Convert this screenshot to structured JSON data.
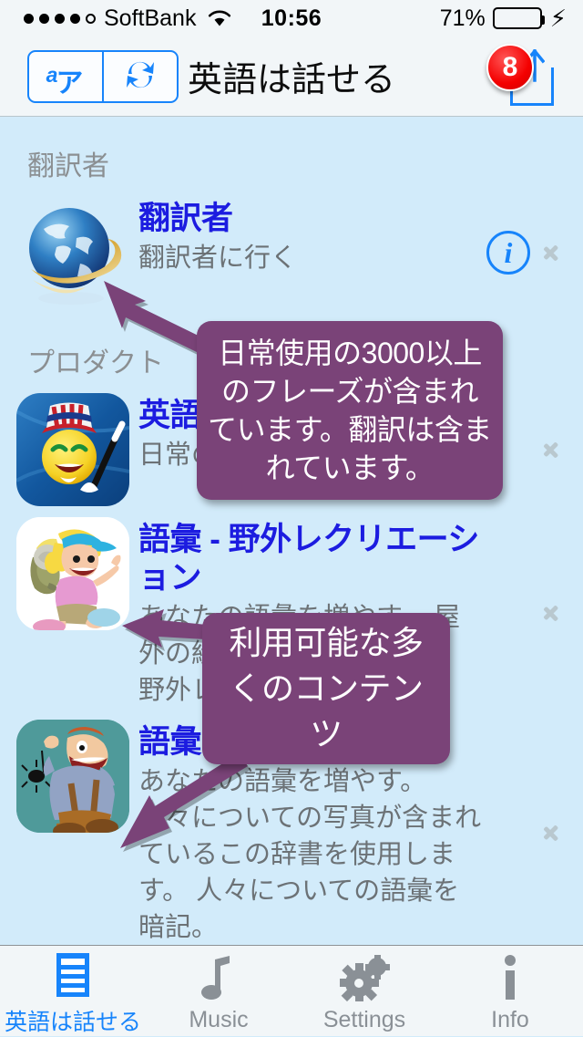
{
  "status_bar": {
    "signal_dots_filled": 4,
    "signal_dots_total": 5,
    "carrier": "SoftBank",
    "wifi_icon": "wifi-icon",
    "time": "10:56",
    "battery_percent": "71%",
    "battery_level": 71,
    "charging": true,
    "battery_color": "#4cd964"
  },
  "navbar": {
    "segmented": {
      "lang_a": "a",
      "lang_kana": "ア",
      "swap_icon": "swap-arrows-icon"
    },
    "title": "英語は話せる",
    "share_icon": "share-icon",
    "badge_count": "8",
    "badge_color": "#f40000",
    "accent_color": "#1784fb"
  },
  "sections": [
    {
      "header": "翻訳者",
      "rows": [
        {
          "icon": "globe-icon",
          "title": "翻訳者",
          "subtitle": "翻訳者に行く",
          "has_info_button": true,
          "info_icon": "info-circle-icon",
          "chevron": "chevron-right-icon"
        }
      ]
    },
    {
      "header": "プロダクト",
      "rows": [
        {
          "icon": "smiley-magician-icon",
          "title": "英語は話せる",
          "subtitle": "日常の英語の言い回し",
          "has_info_button": false,
          "chevron": "chevron-right-icon"
        },
        {
          "icon": "hiker-girl-icon",
          "title": "語彙 - 野外レクリエーション",
          "subtitle": "あなたの語彙を増やす。 屋外の絵辞書を使用します。 野外レクリエーション。",
          "has_info_button": false,
          "chevron": "chevron-right-icon"
        },
        {
          "icon": "cartoon-man-icon",
          "title": "語彙 - 人",
          "subtitle": "あなたの語彙を増やす。 人々についての写真が含まれているこの辞書を使用します。 人々についての語彙を暗記。",
          "has_info_button": false,
          "chevron": "chevron-right-icon"
        }
      ]
    }
  ],
  "tooltips": [
    {
      "name": "translator-tooltip",
      "text": "日常使用の3000以上のフレーズが含まれています。翻訳は含まれています。",
      "color": "#7a4378"
    },
    {
      "name": "content-tooltip",
      "text": "利用可能な多くのコンテンツ",
      "color": "#7a4378"
    }
  ],
  "tabbar": {
    "tabs": [
      {
        "label": "英語は話せる",
        "icon": "document-list-icon",
        "active": true
      },
      {
        "label": "Music",
        "icon": "music-note-icon",
        "active": false
      },
      {
        "label": "Settings",
        "icon": "gears-icon",
        "active": false
      },
      {
        "label": "Info",
        "icon": "info-i-icon",
        "active": false
      }
    ],
    "active_color": "#1784fb",
    "inactive_color": "#8a9096"
  }
}
